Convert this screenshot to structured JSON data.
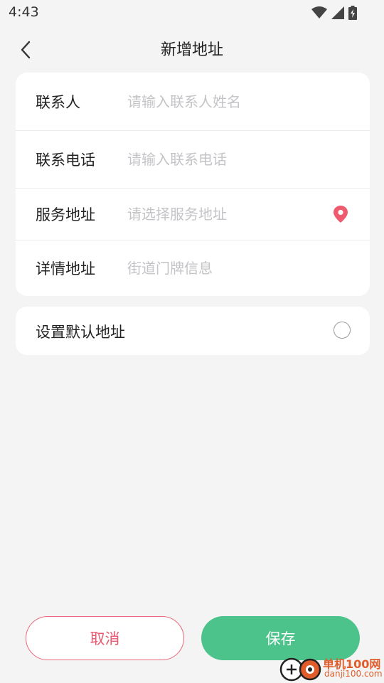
{
  "status_bar": {
    "time": "4:43",
    "icons": [
      "wifi-icon",
      "cellular-signal-icon",
      "battery-charging-icon"
    ]
  },
  "header": {
    "title": "新增地址",
    "back_icon": "chevron-left-icon"
  },
  "form": {
    "contact_name": {
      "label": "联系人",
      "value": "",
      "placeholder": "请输入联系人姓名"
    },
    "contact_phone": {
      "label": "联系电话",
      "value": "",
      "placeholder": "请输入联系电话"
    },
    "service_address": {
      "label": "服务地址",
      "value": "",
      "placeholder": "请选择服务地址",
      "icon": "location-pin-icon"
    },
    "detail_address": {
      "label": "详情地址",
      "value": "",
      "placeholder": "街道门牌信息"
    }
  },
  "default_address": {
    "label": "设置默认地址",
    "checked": false
  },
  "actions": {
    "cancel_label": "取消",
    "save_label": "保存"
  },
  "watermark": {
    "text": "单机100网",
    "subtext": "danji100.com"
  },
  "colors": {
    "background": "#f4f4f4",
    "card": "#ffffff",
    "accent_green": "#4cc38a",
    "accent_red": "#e85a70",
    "location_pin": "#ee5b6f",
    "placeholder": "#c4c4c8"
  }
}
